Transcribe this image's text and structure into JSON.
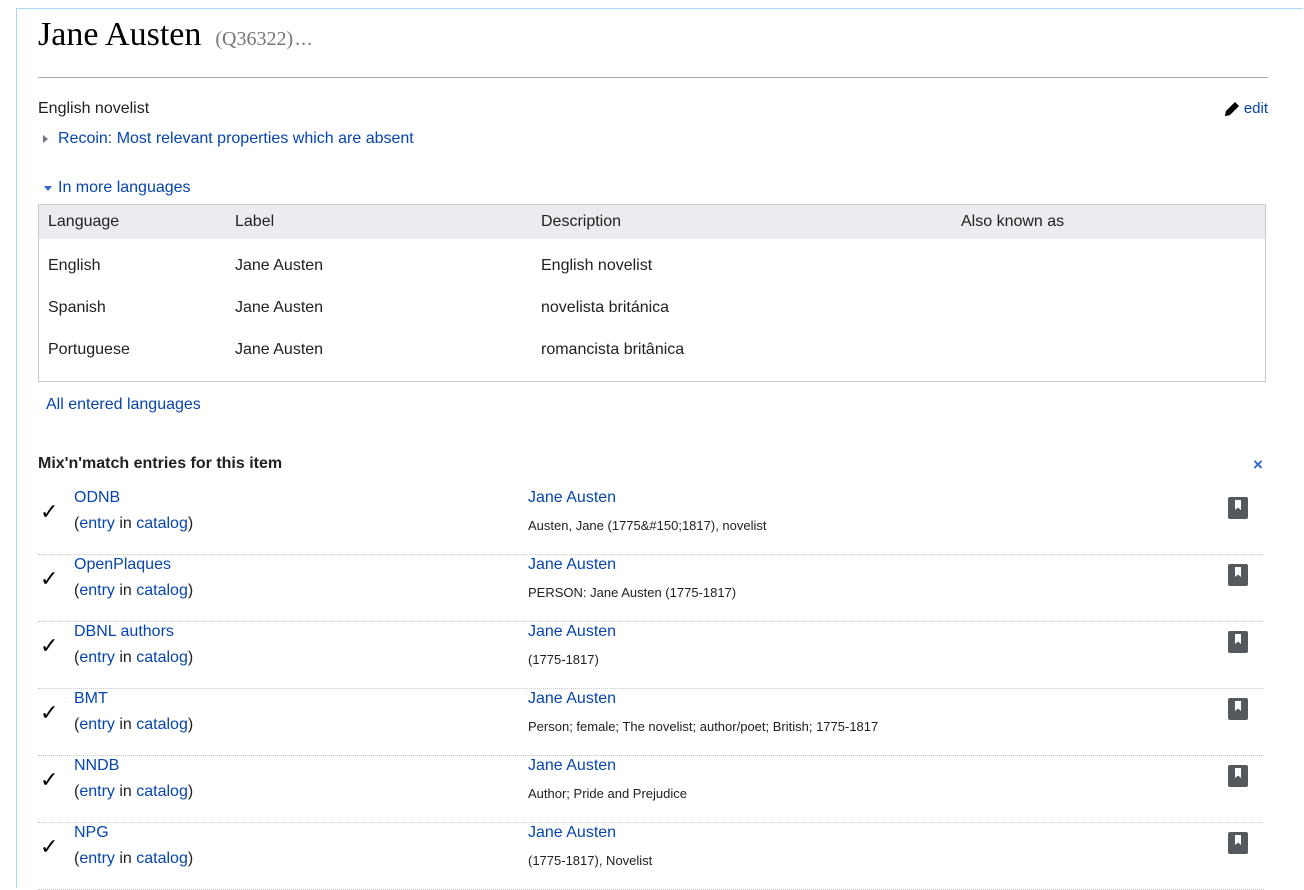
{
  "header": {
    "title": "Jane Austen",
    "qid": "(Q36322)",
    "more": "..."
  },
  "description": "English novelist",
  "edit_label": "edit",
  "recoin_label": "Recoin: Most relevant properties which are absent",
  "more_languages_label": "In more languages",
  "languages_table": {
    "headers": [
      "Language",
      "Label",
      "Description",
      "Also known as"
    ],
    "rows": [
      {
        "language": "English",
        "label": "Jane Austen",
        "description": "English novelist",
        "aka": ""
      },
      {
        "language": "Spanish",
        "label": "Jane Austen",
        "description": "novelista británica",
        "aka": ""
      },
      {
        "language": "Portuguese",
        "label": "Jane Austen",
        "description": "romancista britânica",
        "aka": ""
      }
    ]
  },
  "all_languages_link": "All entered languages",
  "mixnmatch": {
    "title": "Mix'n'match entries for this item",
    "close": "×",
    "entry_open": "(",
    "entry_word": "entry",
    "in_word": " in ",
    "catalog_word": "catalog",
    "entry_close": ")",
    "check_glyph": "✓",
    "entries": [
      {
        "catalog": "ODNB",
        "match": "Jane Austen",
        "detail": "Austen, Jane (1775&#150;1817), novelist"
      },
      {
        "catalog": "OpenPlaques",
        "match": "Jane Austen",
        "detail": "PERSON: Jane Austen (1775-1817)"
      },
      {
        "catalog": "DBNL authors",
        "match": "Jane Austen",
        "detail": "(1775-1817)"
      },
      {
        "catalog": "BMT",
        "match": "Jane Austen",
        "detail": "Person; female; The novelist; author/poet; British; 1775-1817"
      },
      {
        "catalog": "NNDB",
        "match": "Jane Austen",
        "detail": "Author; Pride and Prejudice"
      },
      {
        "catalog": "NPG",
        "match": "Jane Austen",
        "detail": "(1775-1817), Novelist"
      }
    ]
  },
  "colors": {
    "link": "#0645ad",
    "accent": "#3366cc",
    "table_header_bg": "#eaecf0",
    "border": "#c8ccd1"
  },
  "icons": {
    "edit": "pencil-icon",
    "recoin": "triangle-right-icon",
    "more_languages": "triangle-down-icon",
    "confirmed": "checkmark-icon",
    "bookmark": "bookmark-icon",
    "close": "close-icon"
  }
}
